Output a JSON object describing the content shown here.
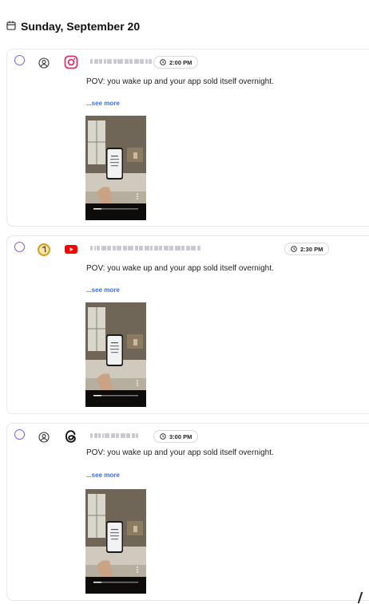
{
  "day": {
    "label": "Sunday, September 20",
    "icon": "calendar-icon"
  },
  "posts": [
    {
      "platform": "Instagram",
      "platform_icon": "instagram-icon",
      "avatar_icon": "user-circle-icon",
      "time": "2:00 PM",
      "caption": "POV: you wake up and your app sold itself overnight.",
      "see_more": "...see more",
      "brand_color": "#e1306c"
    },
    {
      "platform": "YouTube",
      "platform_icon": "youtube-icon",
      "avatar_icon": "channel-avatar-icon",
      "time": "2:30 PM",
      "caption": "POV: you wake up and your app sold itself overnight.",
      "see_more": "...see more",
      "brand_color": "#ff0000"
    },
    {
      "platform": "Threads",
      "platform_icon": "threads-icon",
      "avatar_icon": "user-circle-icon",
      "time": "3:00 PM",
      "caption": "POV: you wake up and your app sold itself overnight.",
      "see_more": "...see more",
      "brand_color": "#000000"
    }
  ],
  "colors": {
    "checkbox": "#7c5cf0",
    "link": "#3b6de0",
    "border": "#e7e7ea"
  }
}
